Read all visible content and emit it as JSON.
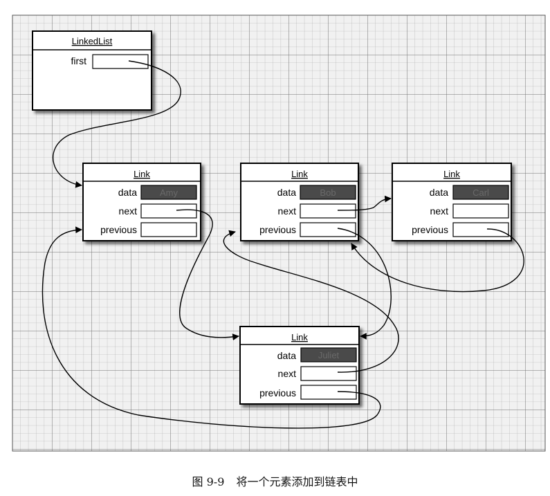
{
  "linkedlist": {
    "title": "LinkedList",
    "first_label": "first"
  },
  "nodes": {
    "amy": {
      "title": "Link",
      "data_label": "data",
      "next_label": "next",
      "previous_label": "previous",
      "value": "Amy"
    },
    "bob": {
      "title": "Link",
      "data_label": "data",
      "next_label": "next",
      "previous_label": "previous",
      "value": "Bob"
    },
    "carl": {
      "title": "Link",
      "data_label": "data",
      "next_label": "next",
      "previous_label": "previous",
      "value": "Carl"
    },
    "juliet": {
      "title": "Link",
      "data_label": "data",
      "next_label": "next",
      "previous_label": "previous",
      "value": "Juliet"
    }
  },
  "caption": {
    "number": "图 9-9",
    "text": "将一个元素添加到链表中"
  },
  "colors": {
    "grid": "#9a9a9a",
    "grid_bg": "#ebebeb",
    "value_fill": "#4a4a4a"
  }
}
